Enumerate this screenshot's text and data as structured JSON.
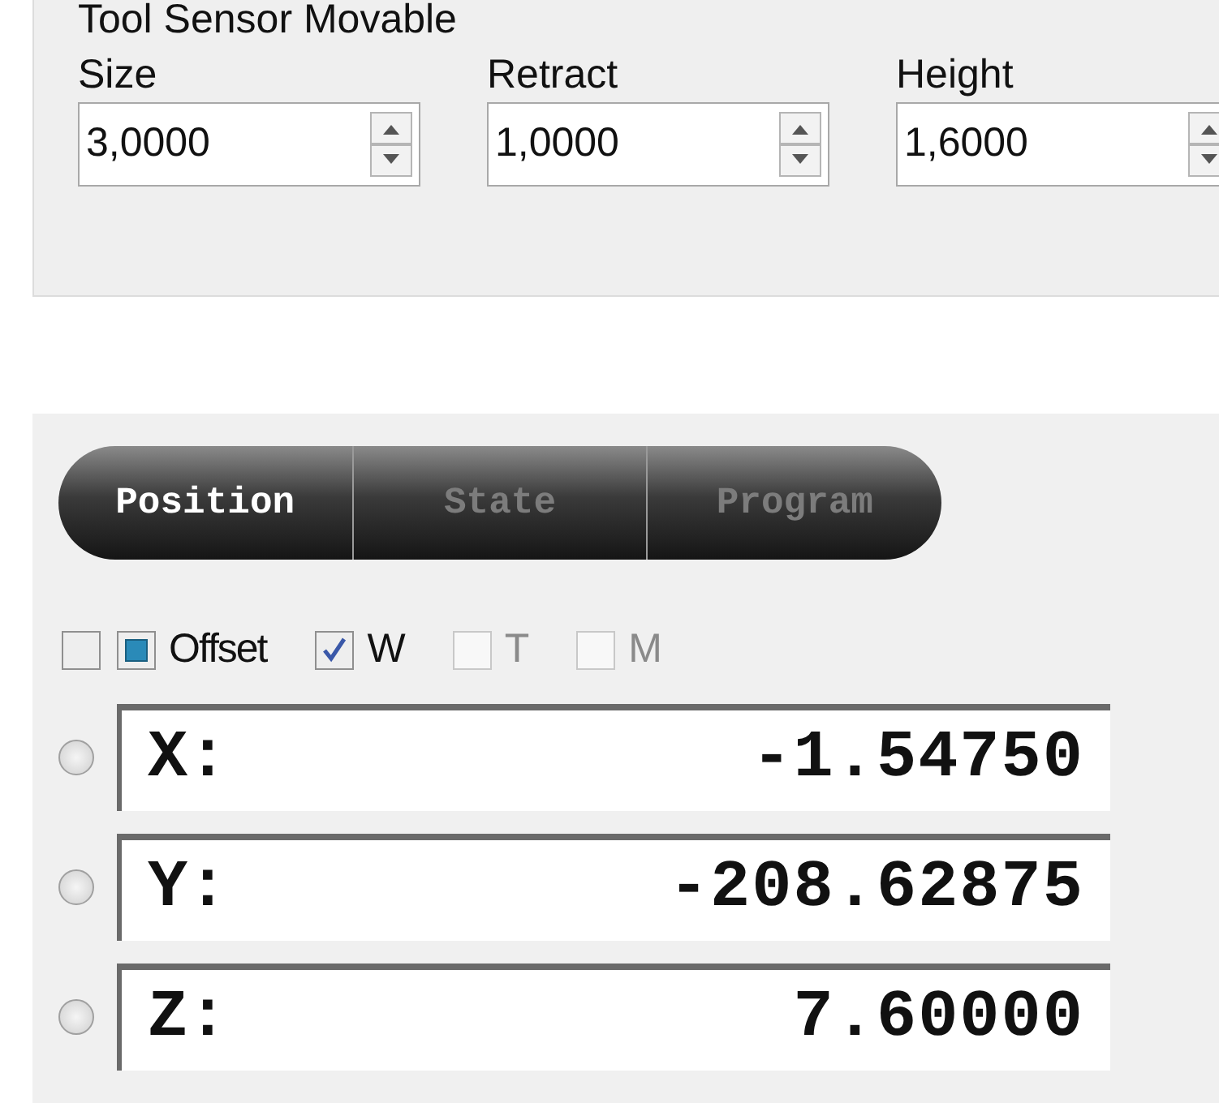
{
  "tool_sensor": {
    "title": "Tool Sensor Movable",
    "fields": [
      {
        "label": "Size",
        "value": "3,0000"
      },
      {
        "label": "Retract",
        "value": "1,0000"
      },
      {
        "label": "Height",
        "value": "1,6000"
      }
    ]
  },
  "tabs": [
    {
      "label": "Position",
      "selected": true
    },
    {
      "label": "State",
      "selected": false
    },
    {
      "label": "Program",
      "selected": false
    }
  ],
  "checkboxes": [
    {
      "checked": false,
      "indeterminate": false,
      "disabled": false
    },
    {
      "label": "Offset",
      "checked": false,
      "indeterminate": true,
      "disabled": false
    },
    {
      "label": "W",
      "checked": true,
      "indeterminate": false,
      "disabled": false
    },
    {
      "label": "T",
      "checked": false,
      "indeterminate": false,
      "disabled": true
    },
    {
      "label": "M",
      "checked": false,
      "indeterminate": false,
      "disabled": true
    }
  ],
  "axes": [
    {
      "label": "X:",
      "value": "-1.54750",
      "selected": false
    },
    {
      "label": "Y:",
      "value": "-208.62875",
      "selected": false
    },
    {
      "label": "Z:",
      "value": "7.60000",
      "selected": false
    }
  ]
}
